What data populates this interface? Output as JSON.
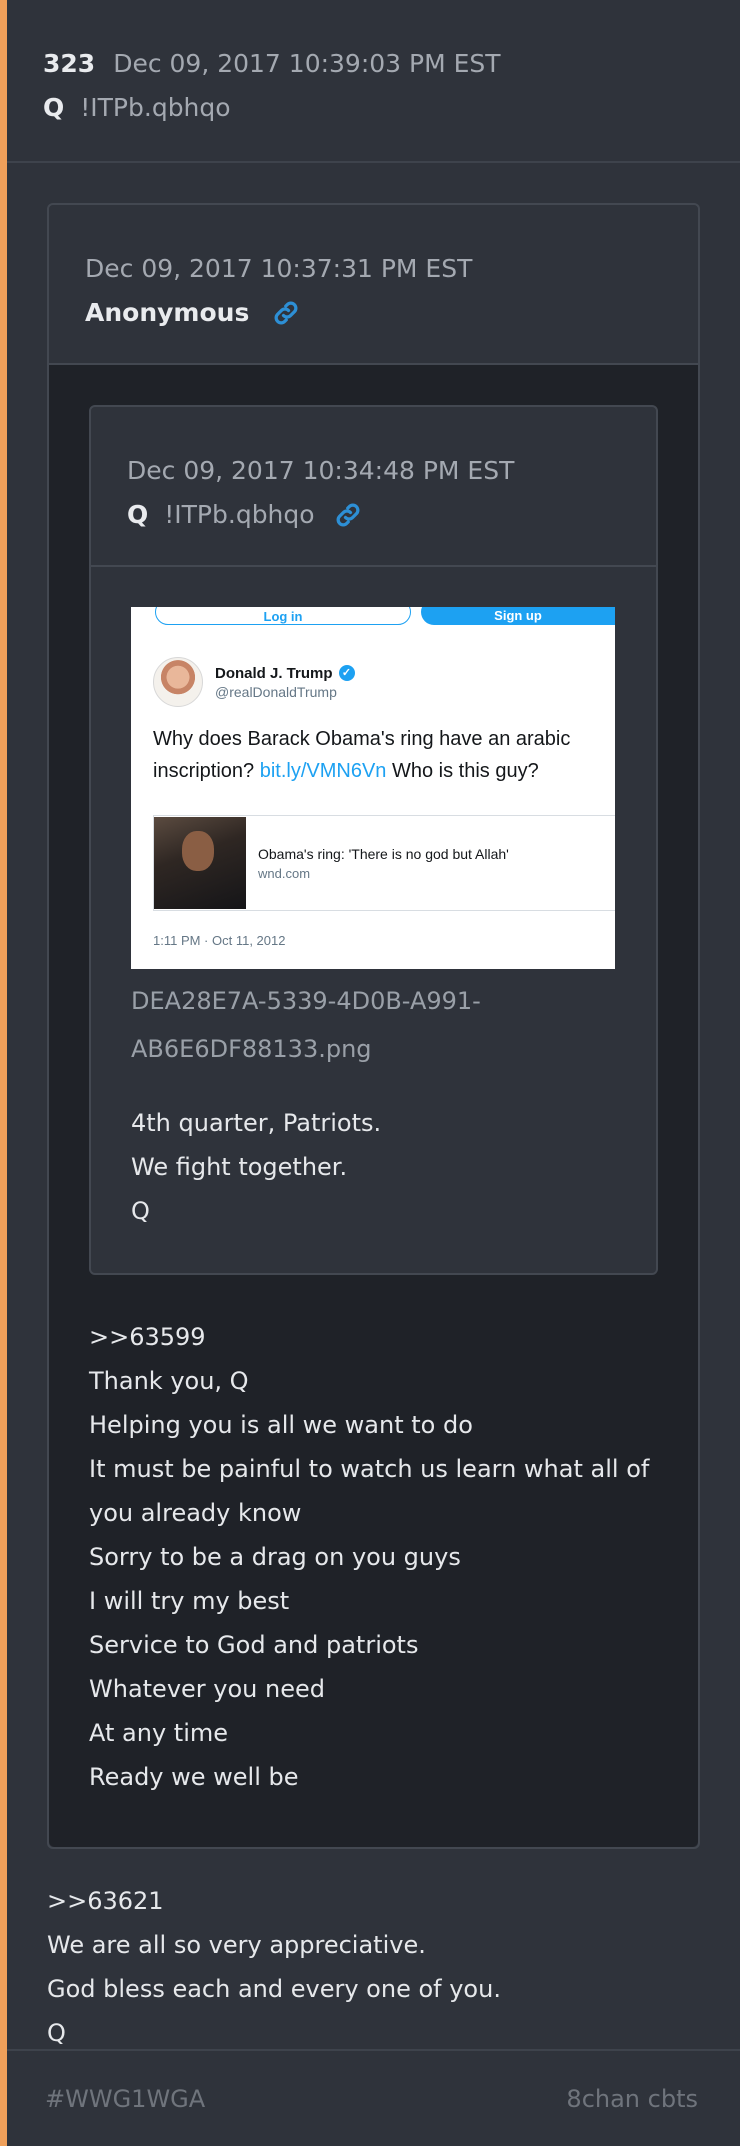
{
  "post": {
    "number": "323",
    "timestamp": "Dec 09, 2017 10:39:03 PM EST",
    "author": "Q",
    "tripcode": "!ITPb.qbhqo"
  },
  "quoted": {
    "timestamp": "Dec 09, 2017 10:37:31 PM EST",
    "author": "Anonymous",
    "lines": [
      ">>63599",
      "Thank you, Q",
      "Helping you is all we want to do",
      "It must be painful to watch us learn what all of you already know",
      "Sorry to be a drag on you guys",
      "I will try my best",
      "Service to God and patriots",
      "Whatever you need",
      "At any time",
      "Ready we well be"
    ]
  },
  "nested": {
    "timestamp": "Dec 09, 2017 10:34:48 PM EST",
    "author": "Q",
    "tripcode": "!ITPb.qbhqo",
    "filename_line1": "DEA28E7A-5339-4D0B-A991-",
    "filename_line2": "AB6E6DF88133.png",
    "lines": [
      "4th quarter, Patriots.",
      "We fight together.",
      "Q"
    ]
  },
  "tweet": {
    "login_label": "Log in",
    "signup_label": "Sign up",
    "name": "Donald J. Trump",
    "handle": "@realDonaldTrump",
    "text_before": "Why does Barack Obama's ring have an arabic inscription? ",
    "link": "bit.ly/VMN6Vn",
    "text_after": " Who is this guy?",
    "card_title": "Obama's ring: 'There is no god but Allah'",
    "card_domain": "wnd.com",
    "time": "1:11 PM · Oct 11, 2012"
  },
  "reply_lines": [
    ">>63621",
    "We are all so very appreciative.",
    "God bless each and every one of you.",
    "Q"
  ],
  "footer": {
    "hashtag": "#WWG1WGA",
    "source": "8chan cbts"
  },
  "colors": {
    "accent_bar": "#f0a05a",
    "link_icon": "#2d8fd5",
    "twitter_blue": "#1da1f2"
  }
}
